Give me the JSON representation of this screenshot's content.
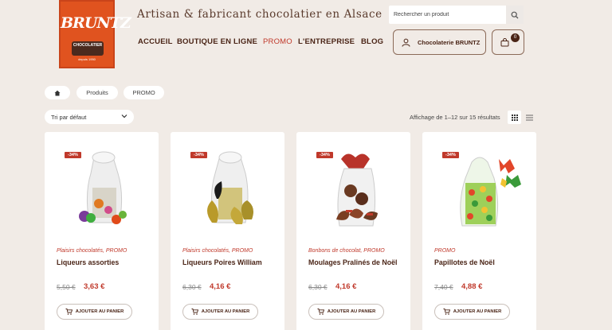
{
  "header": {
    "logo_text": "BRUNTZ",
    "logo_badge_text": "CHOCOLATIER",
    "logo_badge_sub": "depuis 1950",
    "tagline": "Artisan & fabricant chocolatier en Alsace",
    "search_placeholder": "Rechercher un produit",
    "account_label": "Chocolaterie BRUNTZ",
    "cart_count": "0"
  },
  "nav": {
    "accueil": "ACCUEIL",
    "boutique": "BOUTIQUE EN LIGNE",
    "promo": "PROMO",
    "entreprise": "L'ENTREPRISE",
    "blog": "BLOG"
  },
  "breadcrumb": {
    "produits": "Produits",
    "promo": "PROMO"
  },
  "toolbar": {
    "sort_label": "Tri par défaut",
    "results_text": "Affichage de 1–12 sur 15 résultats"
  },
  "products": [
    {
      "badge": "-34%",
      "category": "Plaisirs chocolatés, PROMO",
      "name": "Liqueurs assorties",
      "old_price": "5,50 €",
      "new_price": "3,63 €",
      "button": "AJOUTER AU PANIER"
    },
    {
      "badge": "-34%",
      "category": "Plaisirs chocolatés, PROMO",
      "name": "Liqueurs Poires William",
      "old_price": "6,30 €",
      "new_price": "4,16 €",
      "button": "AJOUTER AU PANIER"
    },
    {
      "badge": "-34%",
      "category": "Bonbons de chocolat, PROMO",
      "name": "Moulages Pralinés de Noël",
      "old_price": "6,30 €",
      "new_price": "4,16 €",
      "button": "AJOUTER AU PANIER"
    },
    {
      "badge": "-34%",
      "category": "PROMO",
      "name": "Papillotes de Noël",
      "old_price": "7,40 €",
      "new_price": "4,88 €",
      "button": "AJOUTER AU PANIER"
    }
  ],
  "colors": {
    "background": "#f1ebe6",
    "brand_orange": "#e0531f",
    "accent_red": "#c0392b",
    "text_brown": "#4a2416"
  }
}
